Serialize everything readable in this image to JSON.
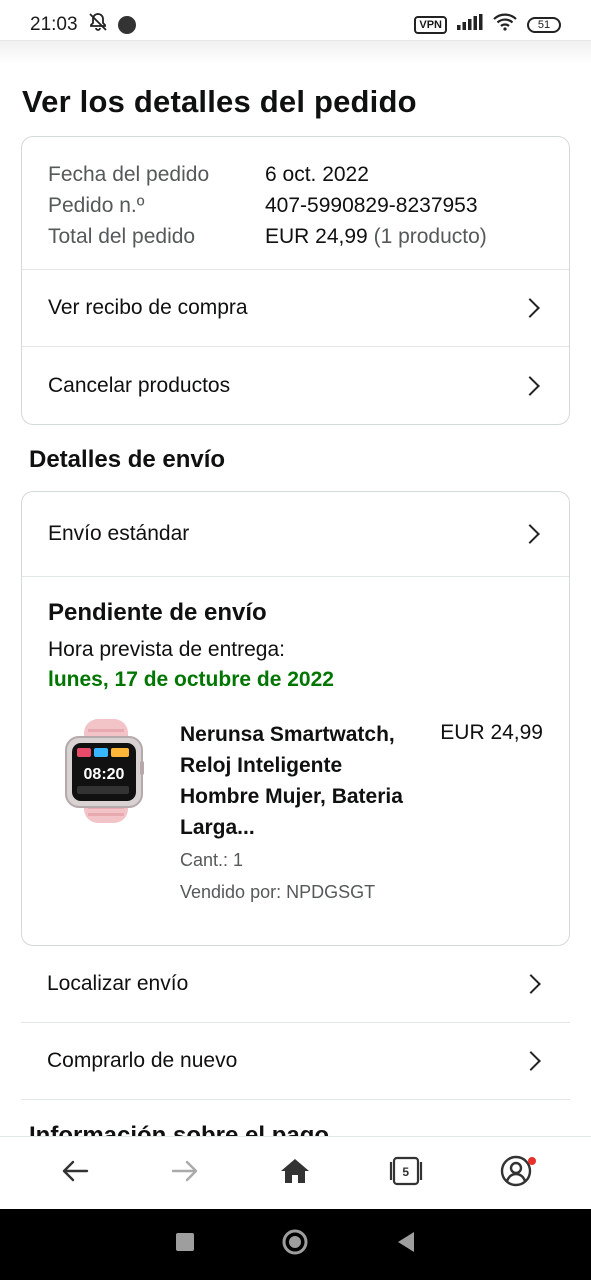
{
  "status_bar": {
    "time": "21:03",
    "vpn": "VPN",
    "battery": "51"
  },
  "page": {
    "title": "Ver los detalles del pedido"
  },
  "order_summary": {
    "rows": [
      {
        "label": "Fecha del pedido",
        "value": "6 oct. 2022",
        "extra": ""
      },
      {
        "label": "Pedido n.º",
        "value": "407-5990829-8237953",
        "extra": ""
      },
      {
        "label": "Total del pedido",
        "value": "EUR 24,99",
        "extra": "(1 producto)"
      }
    ],
    "links": [
      {
        "label": "Ver recibo de compra"
      },
      {
        "label": "Cancelar productos"
      }
    ]
  },
  "shipping": {
    "section_title": "Detalles de envío",
    "method": "Envío estándar",
    "status": "Pendiente de envío",
    "eta_label": "Hora prevista de entrega:",
    "eta_date": "lunes, 17 de octubre de 2022",
    "product": {
      "name": "Nerunsa Smartwatch, Reloj Inteligente Hombre Mujer, Bateria Larga...",
      "quantity": "Cant.: 1",
      "seller": "Vendido por: NPDGSGT",
      "price": "EUR 24,99",
      "watch_time": "08:20"
    }
  },
  "actions": [
    {
      "label": "Localizar envío"
    },
    {
      "label": "Comprarlo de nuevo"
    }
  ],
  "partial_section": "Información sobre el pago",
  "bottom_nav": {
    "cart_count": "5"
  },
  "colors": {
    "eta_green": "#007600",
    "border": "#d5d9d9",
    "notification_dot": "#e7322b"
  }
}
